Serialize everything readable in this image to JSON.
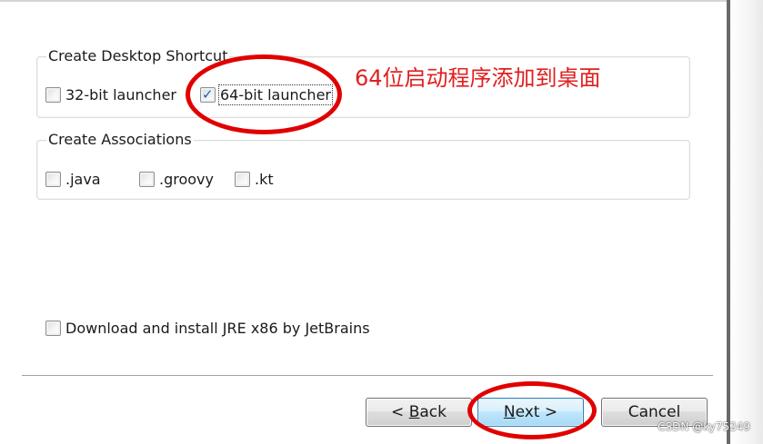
{
  "desktop_shortcut": {
    "legend": "Create Desktop Shortcut",
    "items": [
      {
        "label": "32-bit launcher",
        "checked": false
      },
      {
        "label": "64-bit launcher",
        "checked": true
      }
    ]
  },
  "associations": {
    "legend": "Create Associations",
    "items": [
      {
        "label": ".java",
        "checked": false
      },
      {
        "label": ".groovy",
        "checked": false
      },
      {
        "label": ".kt",
        "checked": false
      }
    ]
  },
  "jre": {
    "label": "Download and install JRE x86 by JetBrains",
    "checked": false
  },
  "buttons": {
    "back_prefix": "< ",
    "back_accel": "B",
    "back_rest": "ack",
    "next_accel": "N",
    "next_rest": "ext >",
    "cancel": "Cancel"
  },
  "annotation": {
    "text": "64位启动程序添加到桌面",
    "color": "#e00000"
  },
  "watermark": "CSDN @ky75249",
  "icons": {
    "checkmark": "checkmark-icon"
  }
}
